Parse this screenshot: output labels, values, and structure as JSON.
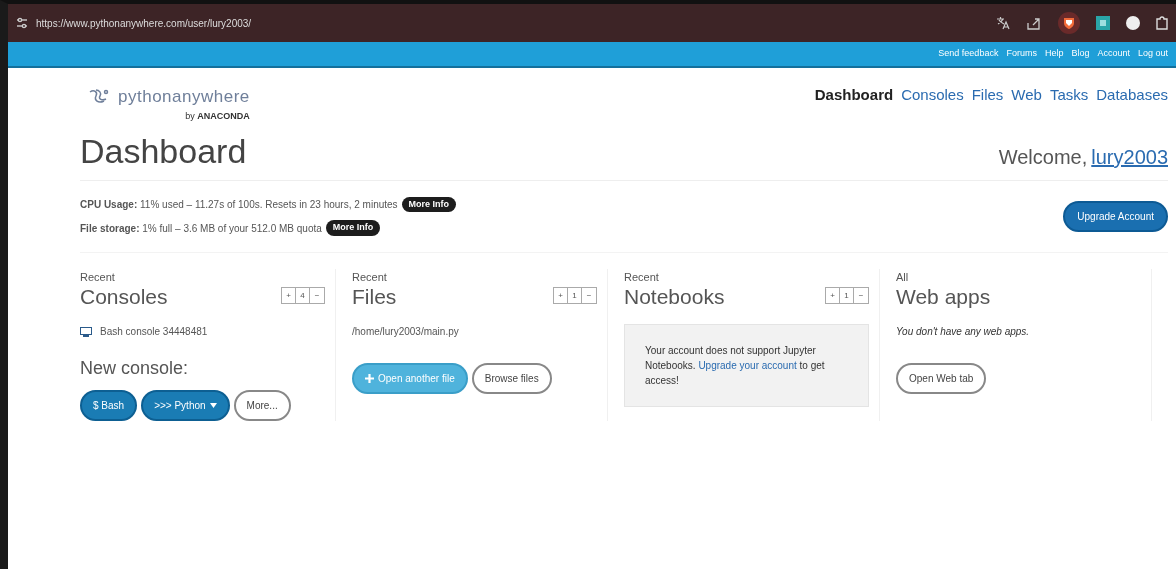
{
  "browser": {
    "url": "https://www.pythonanywhere.com/user/lury2003/"
  },
  "top_links": [
    "Send feedback",
    "Forums",
    "Help",
    "Blog",
    "Account",
    "Log out"
  ],
  "logo": {
    "name": "pythonanywhere",
    "byline": "by **ANACONDA**"
  },
  "nav": [
    {
      "label": "Dashboard",
      "selected": true
    },
    {
      "label": "Consoles",
      "selected": false
    },
    {
      "label": "Files",
      "selected": false
    },
    {
      "label": "Web",
      "selected": false
    },
    {
      "label": "Tasks",
      "selected": false
    },
    {
      "label": "Databases",
      "selected": false
    }
  ],
  "page_title": "Dashboard",
  "welcome": {
    "prefix": "Welcome,",
    "user": "lury2003"
  },
  "usage": [
    {
      "text": "**CPU Usage:** 11% used – 11.27s of 100s. Resets in 23 hours, 2 minutes",
      "info": "More Info"
    },
    {
      "text": "**File storage:** 1% full – 3.6 MB of your 512.0 MB quota",
      "info": "More Info"
    }
  ],
  "upgrade_button": "Upgrade Account",
  "panels": [
    {
      "kind": "consoles",
      "kicker": "Recent",
      "title": "Consoles",
      "pager": [
        "+",
        "4",
        "−"
      ],
      "items": [
        "Bash console 34448481"
      ],
      "subtitle": "New console:",
      "buttons": [
        {
          "label": "$ Bash",
          "kind": "primary"
        },
        {
          "label": ">>> Python",
          "kind": "dropdown"
        },
        {
          "label": "More...",
          "kind": "outline"
        }
      ]
    },
    {
      "kind": "files",
      "kicker": "Recent",
      "title": "Files",
      "pager": [
        "+",
        "1",
        "−"
      ],
      "items": [
        "/home/lury2003/main.py"
      ],
      "buttons": [
        {
          "label": "Open another file",
          "kind": "add"
        },
        {
          "label": "Browse files",
          "kind": "outline"
        }
      ]
    },
    {
      "kind": "notebooks",
      "kicker": "Recent",
      "title": "Notebooks",
      "pager": [
        "+",
        "1",
        "−"
      ],
      "notice": {
        "before": "Your account does not support Jupyter Notebooks.",
        "link": "Upgrade your account",
        "after": "to get access!"
      }
    },
    {
      "kind": "webapps",
      "kicker": "All",
      "title": "Web apps",
      "message": "You don't have any web apps.",
      "buttons": [
        {
          "label": "Open Web tab",
          "kind": "outline"
        }
      ]
    }
  ]
}
